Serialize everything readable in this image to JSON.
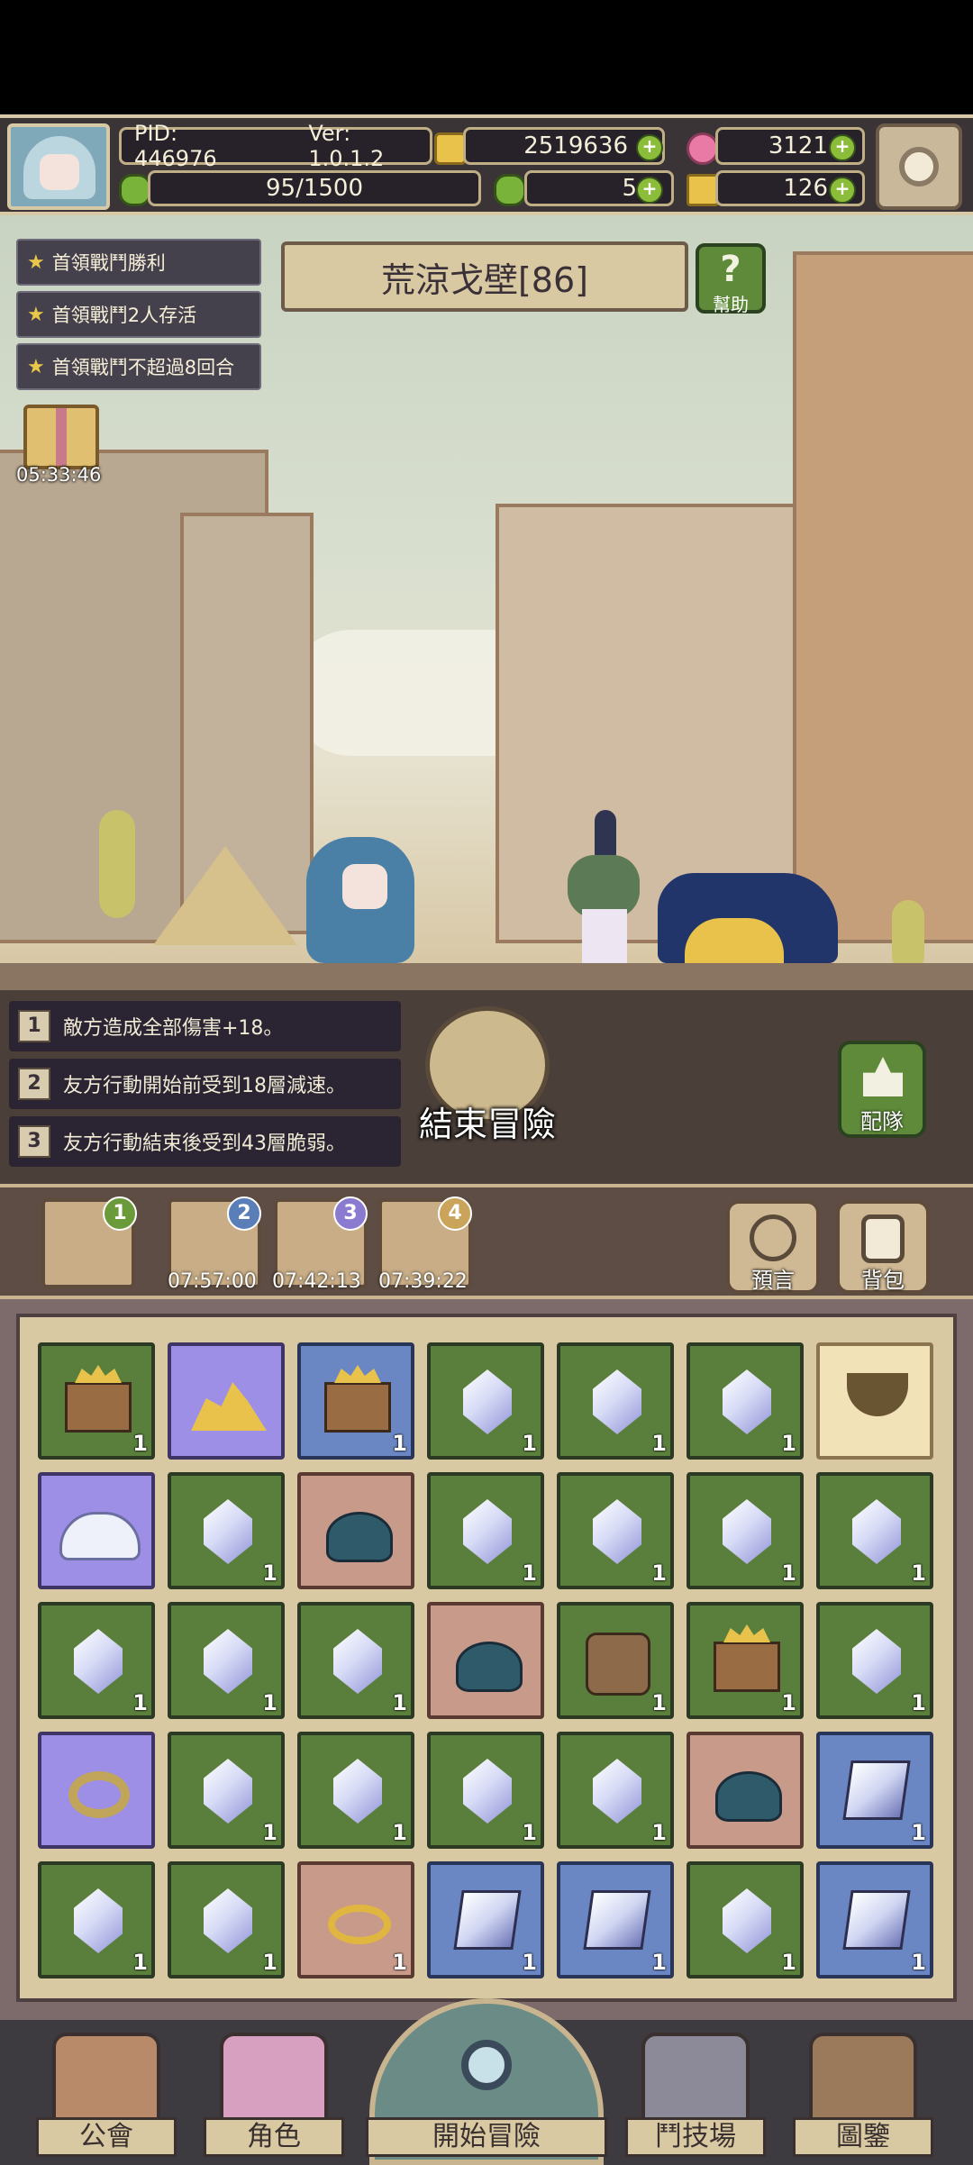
{
  "header": {
    "pid": "PID: 446976",
    "version": "Ver: 1.0.1.2",
    "gold": "2519636",
    "gems": "3121",
    "stamina": "95/1500",
    "clover": "5",
    "keys": "126"
  },
  "quests": [
    {
      "label": "首領戰鬥勝利"
    },
    {
      "label": "首領戰鬥2人存活"
    },
    {
      "label": "首領戰鬥不超過8回合"
    }
  ],
  "gift_timer": "05:33:46",
  "stage": {
    "title": "荒涼戈壁[86]",
    "help_label": "幫助"
  },
  "effects": [
    {
      "num": "1",
      "text": "敵方造成全部傷害+18。"
    },
    {
      "num": "2",
      "text": "友方行動開始前受到18層減速。"
    },
    {
      "num": "3",
      "text": "友方行動結束後受到43層脆弱。"
    }
  ],
  "end_button": "結束冒險",
  "team_button": "配隊",
  "slots": [
    {
      "num": "1",
      "time": ""
    },
    {
      "num": "2",
      "time": "07:57:00"
    },
    {
      "num": "3",
      "time": "07:42:13"
    },
    {
      "num": "4",
      "time": "07:39:22"
    }
  ],
  "prophecy_button": "預言",
  "backpack_button": "背包",
  "inventory_rows": [
    [
      {
        "bg": "green",
        "icon": "chest",
        "count": "1"
      },
      {
        "bg": "purple",
        "icon": "gold",
        "count": ""
      },
      {
        "bg": "blue",
        "icon": "chest",
        "count": "1"
      },
      {
        "bg": "green",
        "icon": "gem",
        "count": "1"
      },
      {
        "bg": "green",
        "icon": "gem",
        "count": "1"
      },
      {
        "bg": "green",
        "icon": "gem",
        "count": "1"
      },
      {
        "bg": "cream",
        "icon": "pot",
        "count": ""
      }
    ],
    [
      {
        "bg": "purple",
        "icon": "cloud",
        "count": ""
      },
      {
        "bg": "green",
        "icon": "gem",
        "count": "1"
      },
      {
        "bg": "pink",
        "icon": "slime",
        "count": ""
      },
      {
        "bg": "green",
        "icon": "gem",
        "count": "1"
      },
      {
        "bg": "green",
        "icon": "gem",
        "count": "1"
      },
      {
        "bg": "green",
        "icon": "gem",
        "count": "1"
      },
      {
        "bg": "green",
        "icon": "gem",
        "count": "1"
      }
    ],
    [
      {
        "bg": "green",
        "icon": "gem",
        "count": "1"
      },
      {
        "bg": "green",
        "icon": "gem",
        "count": "1"
      },
      {
        "bg": "green",
        "icon": "gem",
        "count": "1"
      },
      {
        "bg": "pink",
        "icon": "slime",
        "count": ""
      },
      {
        "bg": "green",
        "icon": "bag",
        "count": "1"
      },
      {
        "bg": "green",
        "icon": "chest",
        "count": "1"
      },
      {
        "bg": "green",
        "icon": "gem",
        "count": "1"
      }
    ],
    [
      {
        "bg": "purple",
        "icon": "ring",
        "count": ""
      },
      {
        "bg": "green",
        "icon": "gem",
        "count": "1"
      },
      {
        "bg": "green",
        "icon": "gem",
        "count": "1"
      },
      {
        "bg": "green",
        "icon": "gem",
        "count": "1"
      },
      {
        "bg": "green",
        "icon": "gem",
        "count": "1"
      },
      {
        "bg": "pink",
        "icon": "slime",
        "count": ""
      },
      {
        "bg": "blue",
        "icon": "cube",
        "count": "1"
      }
    ],
    [
      {
        "bg": "green",
        "icon": "gem",
        "count": "1"
      },
      {
        "bg": "green",
        "icon": "gem",
        "count": "1"
      },
      {
        "bg": "pink",
        "icon": "ringgold",
        "count": "1"
      },
      {
        "bg": "blue",
        "icon": "cube",
        "count": "1"
      },
      {
        "bg": "blue",
        "icon": "cube",
        "count": "1"
      },
      {
        "bg": "green",
        "icon": "gem",
        "count": "1"
      },
      {
        "bg": "blue",
        "icon": "cube",
        "count": "1"
      }
    ]
  ],
  "nav": {
    "guild": "公會",
    "character": "角色",
    "adventure": "開始冒險",
    "arena": "鬥技場",
    "codex": "圖鑒"
  }
}
